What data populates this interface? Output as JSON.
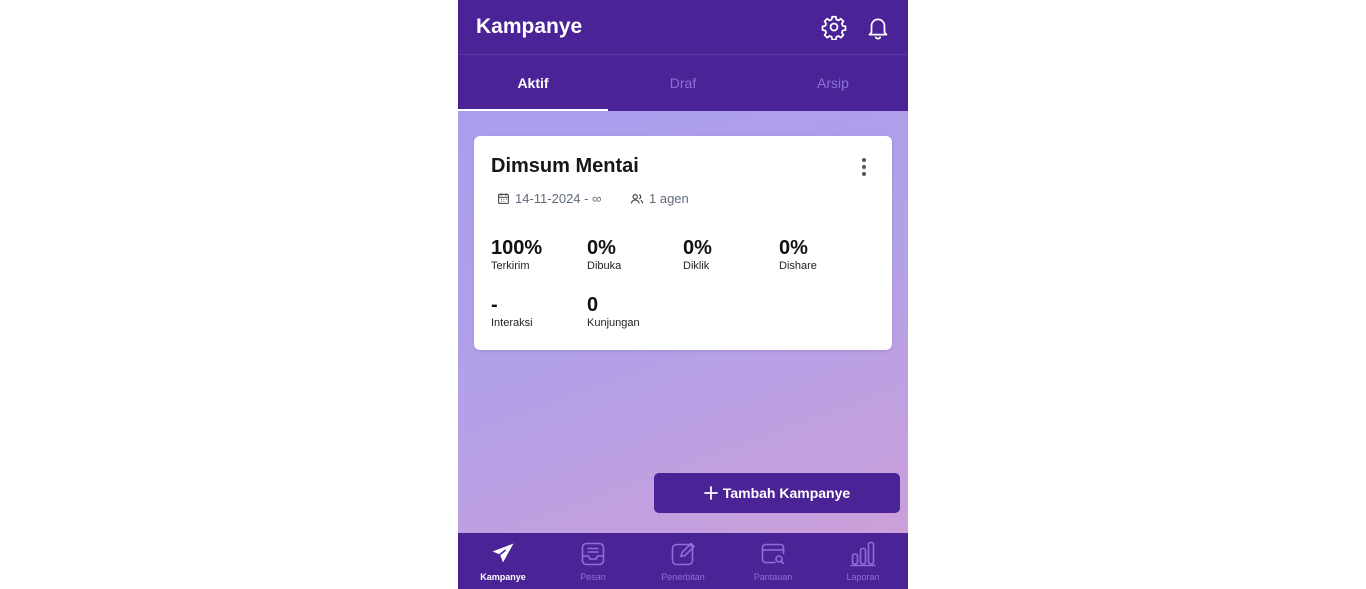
{
  "header": {
    "title": "Kampanye",
    "settings_icon": "gear-icon",
    "notification_icon": "bell-icon"
  },
  "tabs": [
    {
      "label": "Aktif",
      "active": true
    },
    {
      "label": "Draf",
      "active": false
    },
    {
      "label": "Arsip",
      "active": false
    }
  ],
  "campaign": {
    "name": "Dimsum Mentai",
    "date_range": "14-11-2024 - ∞",
    "agents": "1 agen",
    "stats": [
      {
        "value": "100%",
        "label": "Terkirim"
      },
      {
        "value": "0%",
        "label": "Dibuka"
      },
      {
        "value": "0%",
        "label": "Diklik"
      },
      {
        "value": "0%",
        "label": "Dishare"
      },
      {
        "value": "-",
        "label": "Interaksi"
      },
      {
        "value": "0",
        "label": "Kunjungan"
      }
    ]
  },
  "fab": {
    "label": "Tambah Kampanye"
  },
  "bottom_nav": [
    {
      "label": "Kampanye",
      "icon": "paper-plane-icon",
      "active": true
    },
    {
      "label": "Pesan",
      "icon": "inbox-icon",
      "active": false
    },
    {
      "label": "Penerbitan",
      "icon": "edit-icon",
      "active": false
    },
    {
      "label": "Pantauan",
      "icon": "monitor-search-icon",
      "active": false
    },
    {
      "label": "Laporan",
      "icon": "bar-chart-icon",
      "active": false
    }
  ],
  "colors": {
    "primary": "#4a2497",
    "inactive": "#8c6fd6",
    "background_start": "#a79cef",
    "background_end": "#d09fd6"
  }
}
